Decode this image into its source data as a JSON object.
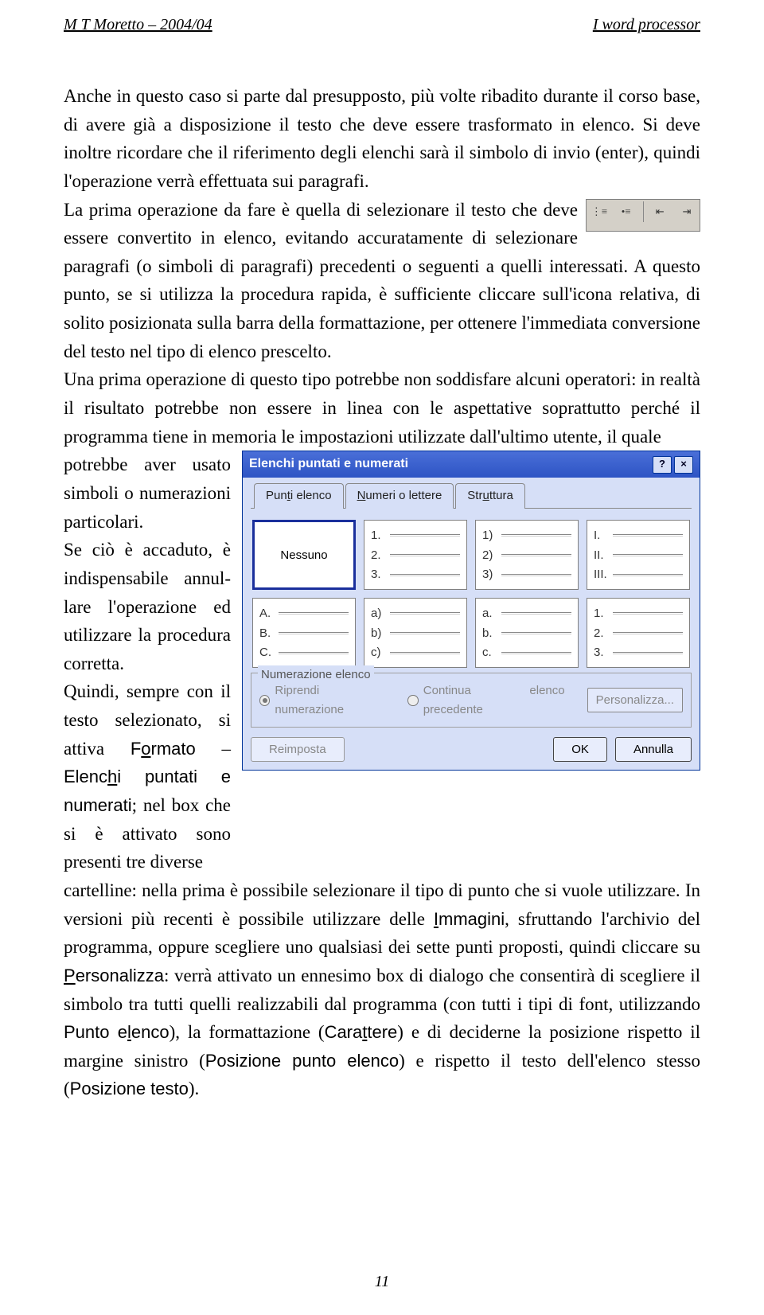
{
  "header": {
    "left": "M T Moretto – 2004/04",
    "right": "I word processor"
  },
  "paragraphs": {
    "p1": "Anche in questo caso si parte dal presupposto, più volte ribadito durante il corso base, di avere già a disposizione il testo che deve essere trasformato in elenco. Si deve inoltre ricordare che il riferimento degli elenchi sarà il simbolo di invio (enter), quindi l'operazione verrà effettuata sui paragrafi.",
    "p2": "La prima operazione da fare è quella di selezionare il testo che deve essere convertito in elenco, evitando accuratamente di selezionare paragrafi (o simboli di paragrafi) precedenti o seguenti a quelli interessati. A questo punto, se si utilizza la procedura rapida, è sufficiente cliccare sull'icona relativa, di solito posizionata sulla barra della formattazione, per ottenere l'immediata conversione del testo nel tipo di elenco prescelto.",
    "p3": "Una prima operazione di questo tipo potrebbe non soddisfare alcuni operatori: in realtà il risultato potrebbe non essere in linea con le aspettative soprattutto perché il programma tiene in memoria le impostazioni utilizzate dall'ultimo utente, il quale",
    "wrap": "potrebbe aver usato simboli o numerazioni particolari.\nSe ciò è accaduto, è indispensabile annul-lare l'operazione ed utilizzare la procedura corretta.\nQuindi, sempre con il testo selezionato, si attiva ",
    "wrap_formato": "Formato",
    "wrap_dash": " – ",
    "wrap_elenchi": "Elenchi puntati e numerati",
    "wrap_after": "; nel box che si è attivato sono presenti tre diverse",
    "p4a": "cartelline: nella prima è possibile selezionare il tipo di punto che si vuole utilizzare. In versioni più recenti è possibile utilizzare delle ",
    "p4_immagini": "Immagini",
    "p4b": ", sfruttando l'archivio del programma, oppure scegliere uno qualsiasi dei sette punti proposti, quindi cliccare su ",
    "p4_pers": "Personalizza",
    "p4c": ": verrà attivato un ennesimo box di dialogo che consentirà di scegliere il simbolo tra tutti quelli realizzabili dal programma (con tutti i tipi di font, utilizzando ",
    "p4_pe": "Punto elenco",
    "p4d": "), la formattazione (",
    "p4_car": "Carattere",
    "p4e": ") e di deciderne la posizione rispetto il margine sinistro (",
    "p4_ppe": "Posizione punto elenco",
    "p4f": ") e rispetto il testo dell'elenco stesso (",
    "p4_pt": "Posizione testo",
    "p4g": ")."
  },
  "dialog": {
    "title": "Elenchi puntati e numerati",
    "help": "?",
    "close": "×",
    "tabs": [
      "Punti elenco",
      "Numeri o lettere",
      "Struttura"
    ],
    "active_tab": 1,
    "none": "Nessuno",
    "options_row1": [
      [
        "1.",
        "2.",
        "3."
      ],
      [
        "1)",
        "2)",
        "3)"
      ],
      [
        "I.",
        "II.",
        "III."
      ]
    ],
    "options_row2": [
      [
        "A.",
        "B.",
        "C."
      ],
      [
        "a)",
        "b)",
        "c)"
      ],
      [
        "a.",
        "b.",
        "c."
      ],
      [
        "1.",
        "2.",
        "3."
      ]
    ],
    "fieldset_label": "Numerazione elenco",
    "radio1": "Riprendi numerazione",
    "radio2": "Continua elenco precedente",
    "personalizza": "Personalizza...",
    "reimposta": "Reimposta",
    "ok": "OK",
    "annulla": "Annulla"
  },
  "footer": "11"
}
